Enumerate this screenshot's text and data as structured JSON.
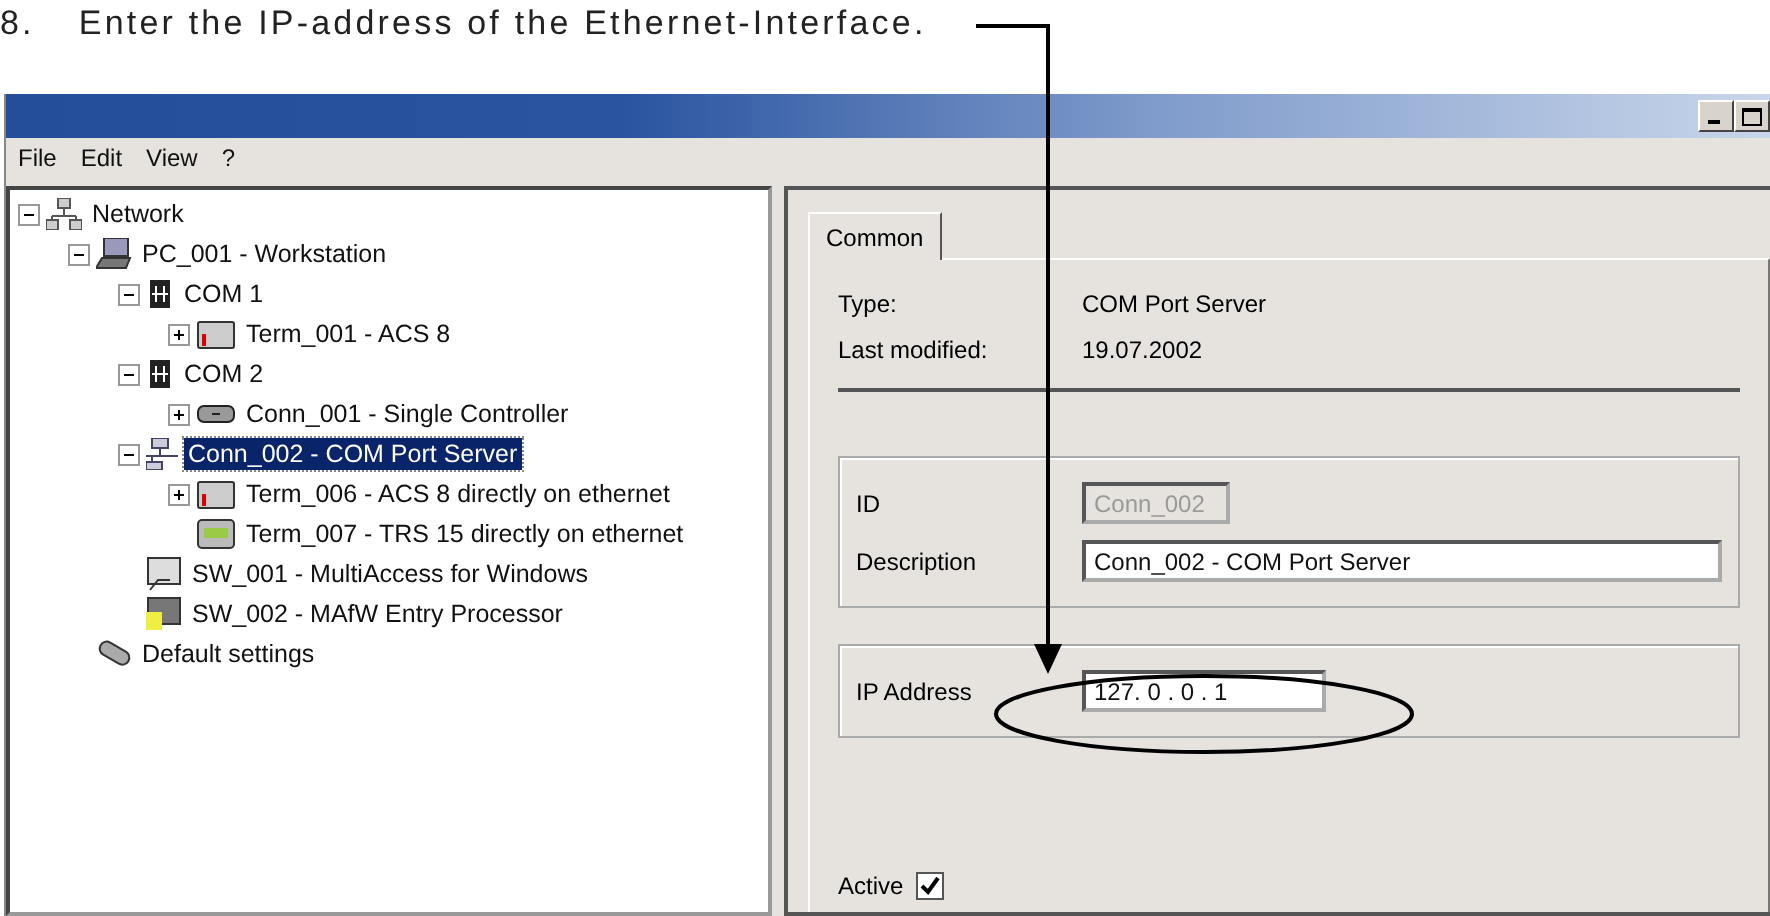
{
  "instruction": {
    "number": "8.",
    "text": "Enter the IP-address of the Ethernet-Interface."
  },
  "menu": [
    "File",
    "Edit",
    "View",
    "?"
  ],
  "tree": [
    {
      "label": "Network",
      "kind": "network",
      "expanded": true,
      "selected": false,
      "children": [
        {
          "label": "PC_001 - Workstation",
          "kind": "computer",
          "expanded": true,
          "selected": false,
          "children": [
            {
              "label": "COM 1",
              "kind": "port",
              "expanded": true,
              "selected": false,
              "children": [
                {
                  "label": "Term_001 - ACS 8",
                  "kind": "terminal",
                  "expanded": false,
                  "selected": false
                }
              ]
            },
            {
              "label": "COM 2",
              "kind": "port",
              "expanded": true,
              "selected": false,
              "children": [
                {
                  "label": "Conn_001 - Single Controller",
                  "kind": "controller",
                  "expanded": false,
                  "selected": false
                }
              ]
            },
            {
              "label": "Conn_002 - COM Port Server",
              "kind": "server",
              "expanded": true,
              "selected": true,
              "children": [
                {
                  "label": "Term_006 - ACS 8 directly on ethernet",
                  "kind": "terminal",
                  "expanded": false,
                  "selected": false
                },
                {
                  "label": "Term_007 - TRS 15 directly on ethernet",
                  "kind": "reader",
                  "selected": false
                }
              ]
            },
            {
              "label": "SW_001 - MultiAccess for Windows",
              "kind": "software",
              "selected": false
            },
            {
              "label": "SW_002 - MAfW Entry Processor",
              "kind": "processor",
              "selected": false
            }
          ]
        },
        {
          "label": "Default settings",
          "kind": "settings",
          "selected": false
        }
      ]
    }
  ],
  "tabs": [
    {
      "label": "Common",
      "selected": true
    }
  ],
  "info": [
    {
      "label": "Type:",
      "value": "COM Port Server"
    },
    {
      "label": "Last modified:",
      "value": "19.07.2002"
    }
  ],
  "fields": [
    {
      "label": "ID",
      "value": "Conn_002",
      "kind": "short",
      "disabled": true
    },
    {
      "label": "Description",
      "value": "Conn_002 - COM Port Server",
      "kind": "long",
      "disabled": false
    }
  ],
  "ip": {
    "label": "IP Address",
    "value": "127. 0 . 0 . 1"
  },
  "active": {
    "label": "Active",
    "checked": true
  }
}
